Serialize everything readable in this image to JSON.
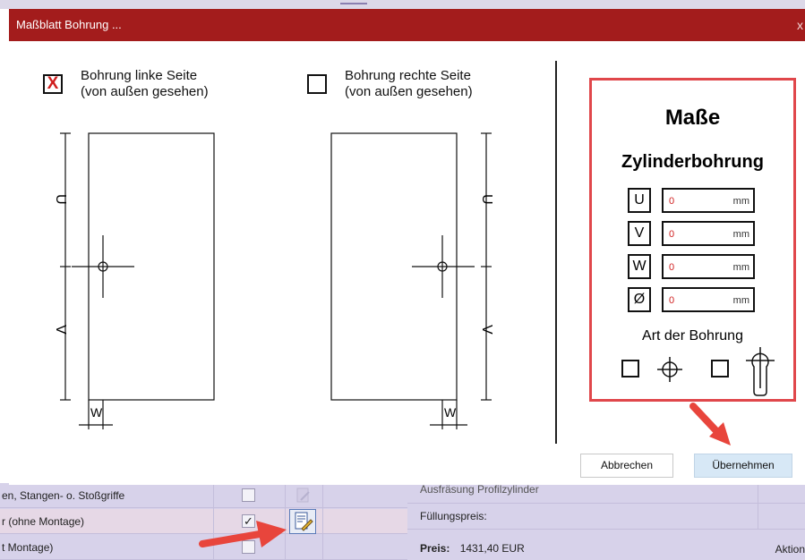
{
  "dialog": {
    "title": "Maßblatt Bohrung ...",
    "close_glyph": "x"
  },
  "options": {
    "left": {
      "line1": "Bohrung linke Seite",
      "line2": "(von außen gesehen)",
      "checked": true,
      "mark": "X"
    },
    "right": {
      "line1": "Bohrung rechte Seite",
      "line2": "(von außen gesehen)",
      "checked": false
    }
  },
  "diagram": {
    "left_labels": {
      "u": "U",
      "v": "V",
      "w": "W"
    },
    "right_labels": {
      "u": "U",
      "v": "V",
      "w": "W"
    }
  },
  "masse": {
    "title": "Maße",
    "subtitle": "Zylinderbohrung",
    "fields": [
      {
        "label": "U",
        "value": "0",
        "unit": "mm"
      },
      {
        "label": "V",
        "value": "0",
        "unit": "mm"
      },
      {
        "label": "W",
        "value": "0",
        "unit": "mm"
      },
      {
        "label": "Ø",
        "value": "0",
        "unit": "mm"
      }
    ],
    "art_label": "Art der Bohrung",
    "art_options": [
      "round-bore-icon",
      "profile-cylinder-icon"
    ]
  },
  "buttons": {
    "cancel": "Abbrechen",
    "apply": "Übernehmen"
  },
  "background": {
    "rows": [
      {
        "label": "en, Stangen- o. Stoßgriffe",
        "checked": false
      },
      {
        "label": "r (ohne Montage)",
        "checked": true
      },
      {
        "label": "t Montage)",
        "checked": false
      }
    ],
    "right_rows": {
      "row_a": "Ausfräsung Profilzylinder",
      "row_b": "Füllungspreis:",
      "price_label": "Preis:",
      "price_value": "1431,40 EUR",
      "action": "Aktion"
    }
  },
  "colors": {
    "titlebar": "#a31c1c",
    "highlight_border": "#e0474b",
    "arrow": "#e8453c",
    "apply_button": "#d7e8f6"
  }
}
